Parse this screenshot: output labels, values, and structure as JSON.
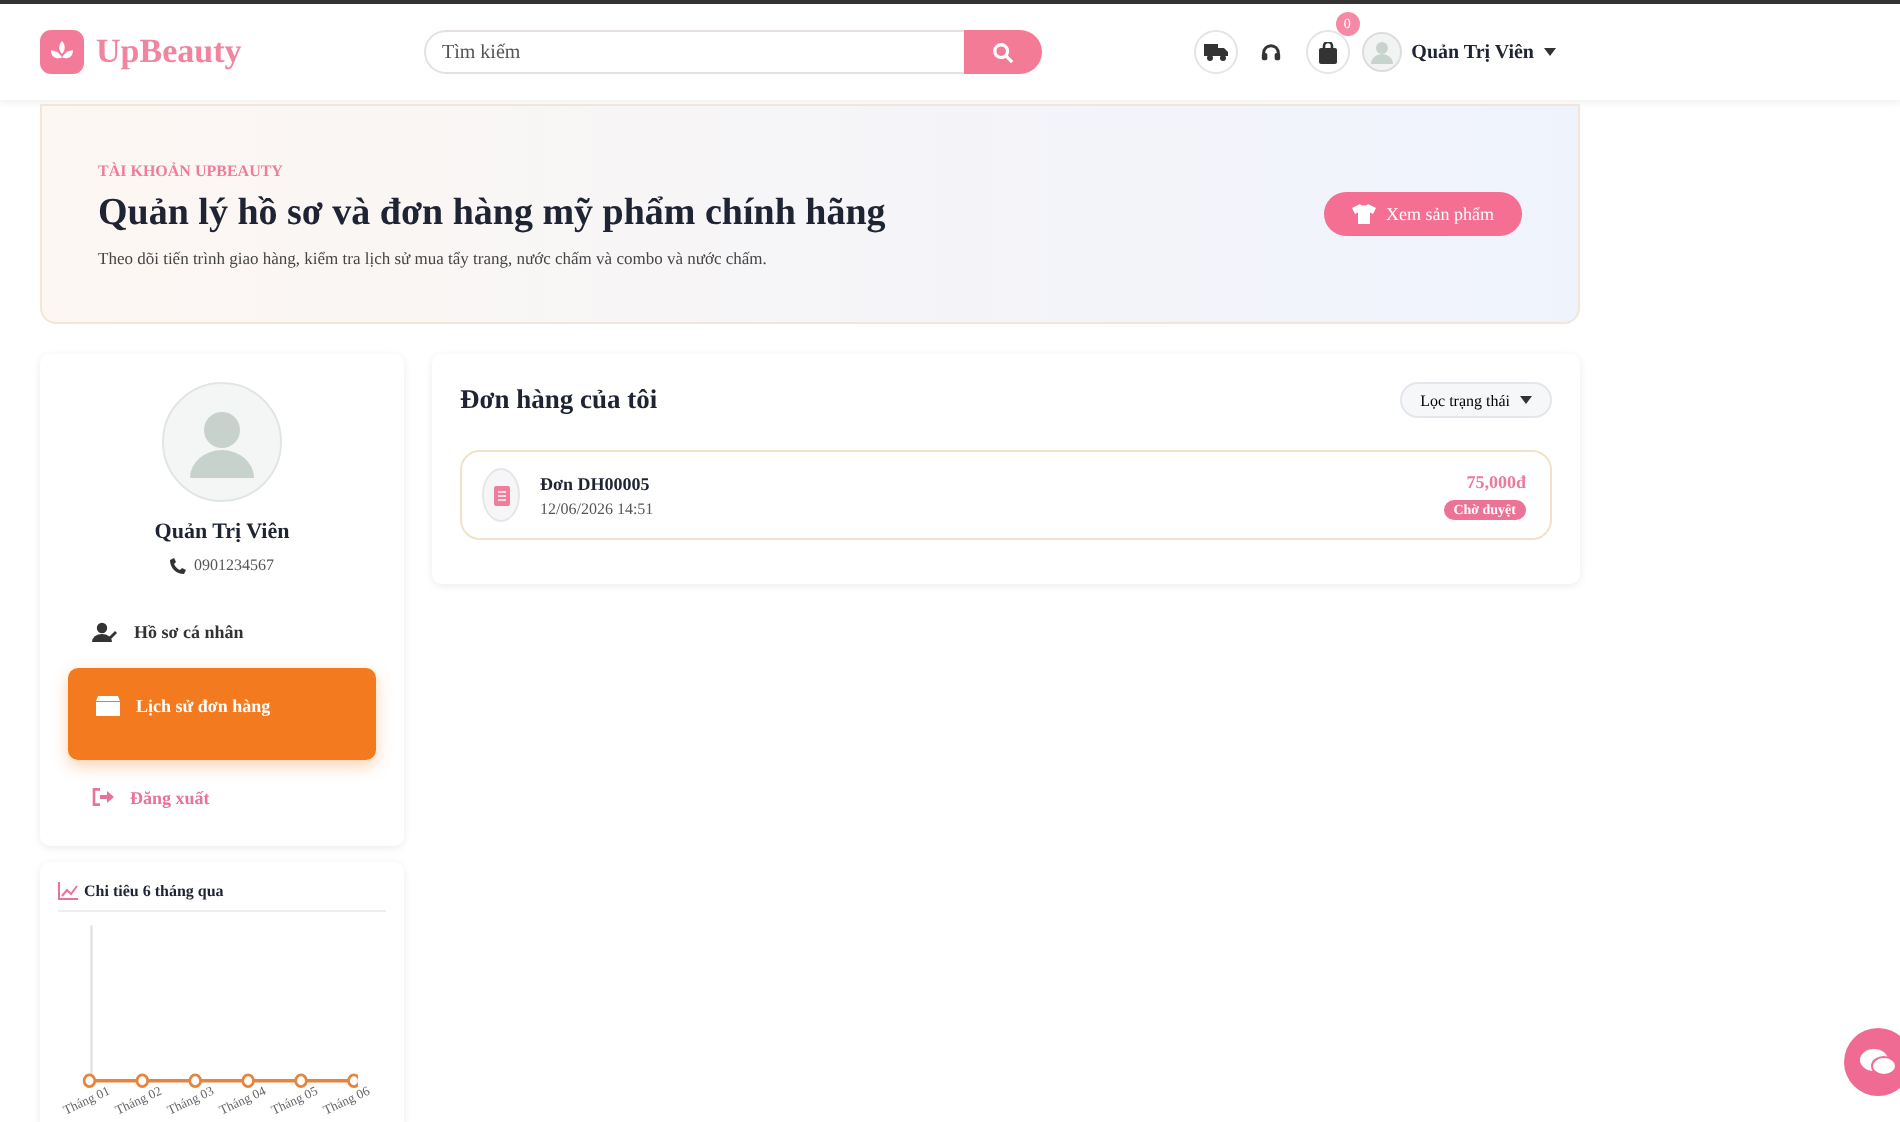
{
  "header": {
    "brand": "UpBeauty",
    "search": {
      "placeholder": "Tìm kiếm"
    },
    "cart_count": "0",
    "user_name": "Quản Trị Viên"
  },
  "hero": {
    "eyebrow": "TÀI KHOẢN UPBEAUTY",
    "title": "Quản lý hồ sơ và đơn hàng mỹ phẩm chính hãng",
    "subtitle": "Theo dõi tiến trình giao hàng, kiểm tra lịch sử mua tẩy trang, nước chấm và combo và nước chấm.",
    "button": "Xem sản phẩm"
  },
  "profile": {
    "name": "Quản Trị Viên",
    "phone": "0901234567"
  },
  "menu": [
    {
      "label": "Hồ sơ cá nhân",
      "kind": "profile",
      "selected": false
    },
    {
      "label": "Lịch sử đơn hàng",
      "kind": "orders",
      "selected": true
    },
    {
      "label": "Đăng xuất",
      "kind": "logout",
      "selected": false
    }
  ],
  "spending": {
    "title": "Chi tiêu 6 tháng qua",
    "month_labels": [
      "Tháng 01",
      "Tháng 02",
      "Tháng 03",
      "Tháng 04",
      "Tháng 05",
      "Tháng 06"
    ]
  },
  "orders": {
    "title": "Đơn hàng của tôi",
    "filter": "Lọc trạng thái",
    "items": [
      {
        "code": "Đơn DH00005",
        "date": "12/06/2026 14:51",
        "total": "75,000đ",
        "status": "Chờ duyệt"
      }
    ]
  }
}
